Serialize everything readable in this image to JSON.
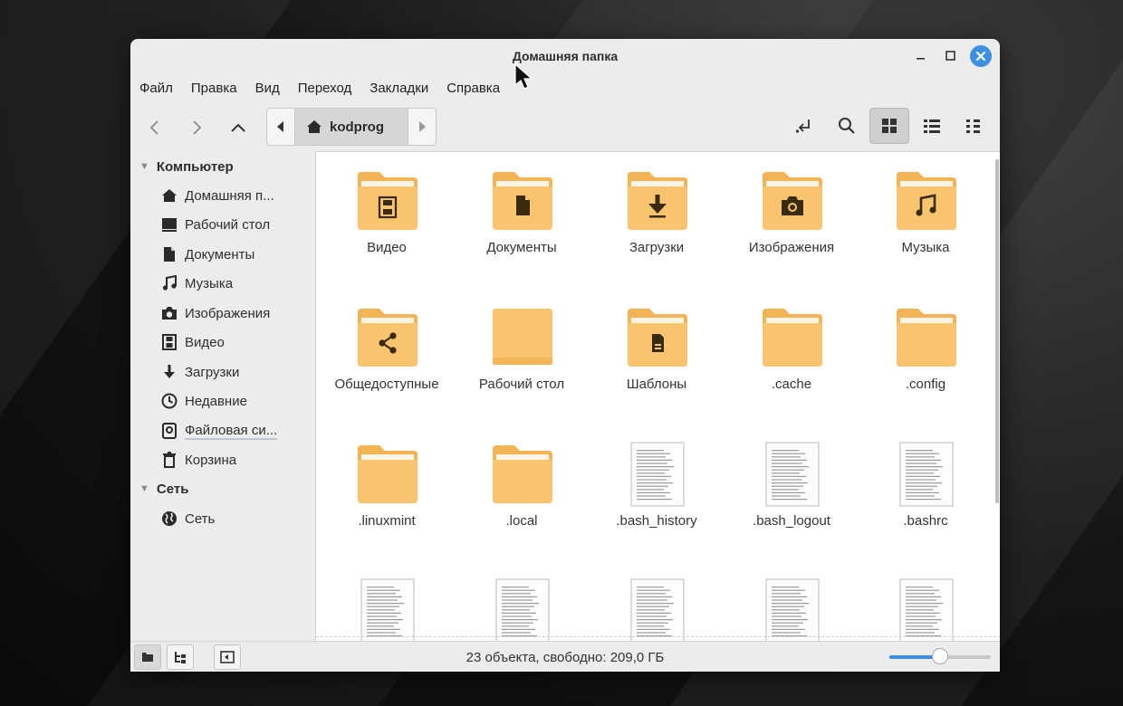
{
  "window": {
    "title": "Домашняя папка",
    "controls": {
      "minimize": "minimize-icon",
      "maximize": "maximize-icon",
      "close": "close-icon"
    }
  },
  "menu": [
    "Файл",
    "Правка",
    "Вид",
    "Переход",
    "Закладки",
    "Справка"
  ],
  "toolbar": {
    "path": "kodprog"
  },
  "sidebar": {
    "sections": [
      {
        "title": "Компьютер",
        "items": [
          {
            "label": "Домашняя п...",
            "icon": "home-icon"
          },
          {
            "label": "Рабочий стол",
            "icon": "desktop-icon"
          },
          {
            "label": "Документы",
            "icon": "document-icon"
          },
          {
            "label": "Музыка",
            "icon": "music-icon"
          },
          {
            "label": "Изображения",
            "icon": "camera-icon"
          },
          {
            "label": "Видео",
            "icon": "film-icon"
          },
          {
            "label": "Загрузки",
            "icon": "download-icon"
          },
          {
            "label": "Недавние",
            "icon": "clock-icon"
          },
          {
            "label": "Файловая си...",
            "icon": "disk-icon"
          },
          {
            "label": "Корзина",
            "icon": "trash-icon"
          }
        ]
      },
      {
        "title": "Сеть",
        "items": [
          {
            "label": "Сеть",
            "icon": "globe-icon"
          }
        ]
      }
    ]
  },
  "files": [
    {
      "name": "Видео",
      "type": "folder",
      "emblem": "film"
    },
    {
      "name": "Документы",
      "type": "folder",
      "emblem": "document"
    },
    {
      "name": "Загрузки",
      "type": "folder",
      "emblem": "download"
    },
    {
      "name": "Изображения",
      "type": "folder",
      "emblem": "camera"
    },
    {
      "name": "Музыка",
      "type": "folder",
      "emblem": "music"
    },
    {
      "name": "Общедоступные",
      "type": "folder",
      "emblem": "share"
    },
    {
      "name": "Рабочий стол",
      "type": "folder-desktop",
      "emblem": ""
    },
    {
      "name": "Шаблоны",
      "type": "folder",
      "emblem": "template"
    },
    {
      "name": ".cache",
      "type": "folder",
      "emblem": ""
    },
    {
      "name": ".config",
      "type": "folder",
      "emblem": ""
    },
    {
      "name": ".linuxmint",
      "type": "folder",
      "emblem": ""
    },
    {
      "name": ".local",
      "type": "folder",
      "emblem": ""
    },
    {
      "name": ".bash_history",
      "type": "text",
      "emblem": ""
    },
    {
      "name": ".bash_logout",
      "type": "text",
      "emblem": ""
    },
    {
      "name": ".bashrc",
      "type": "text",
      "emblem": ""
    },
    {
      "name": "",
      "type": "text",
      "emblem": ""
    },
    {
      "name": "",
      "type": "text",
      "emblem": ""
    },
    {
      "name": "",
      "type": "text",
      "emblem": ""
    },
    {
      "name": "",
      "type": "text",
      "emblem": ""
    },
    {
      "name": "",
      "type": "text",
      "emblem": ""
    }
  ],
  "status": {
    "text": "23 объекта, свободно: 209,0 ГБ",
    "zoom_level": 0.5
  },
  "colors": {
    "folder": "#f9c46e",
    "folder_tab": "#f2b455",
    "accent": "#3d8fe0"
  }
}
